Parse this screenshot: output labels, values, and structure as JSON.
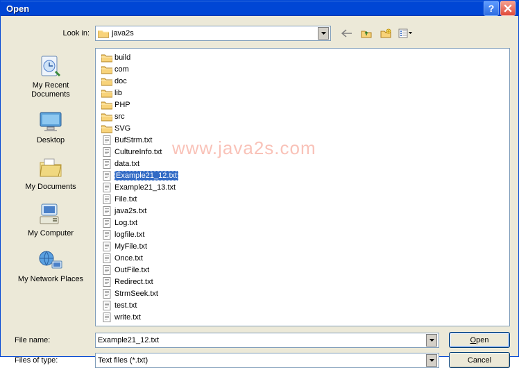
{
  "title": "Open",
  "labels": {
    "look_in": "Look in:",
    "file_name": "File name:",
    "files_of_type": "Files of type:"
  },
  "look_in_value": "java2s",
  "places": [
    {
      "label": "My Recent Documents"
    },
    {
      "label": "Desktop"
    },
    {
      "label": "My Documents"
    },
    {
      "label": "My Computer"
    },
    {
      "label": "My Network Places"
    }
  ],
  "files_col1": [
    {
      "name": "build",
      "type": "folder"
    },
    {
      "name": "com",
      "type": "folder"
    },
    {
      "name": "doc",
      "type": "folder"
    },
    {
      "name": "lib",
      "type": "folder"
    },
    {
      "name": "PHP",
      "type": "folder"
    },
    {
      "name": "src",
      "type": "folder"
    },
    {
      "name": "SVG",
      "type": "folder"
    },
    {
      "name": "BufStrm.txt",
      "type": "file"
    },
    {
      "name": "CultureInfo.txt",
      "type": "file"
    },
    {
      "name": "data.txt",
      "type": "file"
    },
    {
      "name": "Example21_12.txt",
      "type": "file",
      "selected": true
    },
    {
      "name": "Example21_13.txt",
      "type": "file"
    },
    {
      "name": "File.txt",
      "type": "file"
    },
    {
      "name": "java2s.txt",
      "type": "file"
    },
    {
      "name": "Log.txt",
      "type": "file"
    },
    {
      "name": "logfile.txt",
      "type": "file"
    },
    {
      "name": "MyFile.txt",
      "type": "file"
    }
  ],
  "files_col2": [
    {
      "name": "Once.txt",
      "type": "file"
    },
    {
      "name": "OutFile.txt",
      "type": "file"
    },
    {
      "name": "Redirect.txt",
      "type": "file"
    },
    {
      "name": "StrmSeek.txt",
      "type": "file"
    },
    {
      "name": "test.txt",
      "type": "file"
    },
    {
      "name": "write.txt",
      "type": "file"
    }
  ],
  "file_name_value": "Example21_12.txt",
  "files_of_type_value": "Text files (*.txt)",
  "buttons": {
    "open_pre": "",
    "open_u": "O",
    "open_post": "pen",
    "cancel": "Cancel"
  },
  "watermark": "www.java2s.com"
}
